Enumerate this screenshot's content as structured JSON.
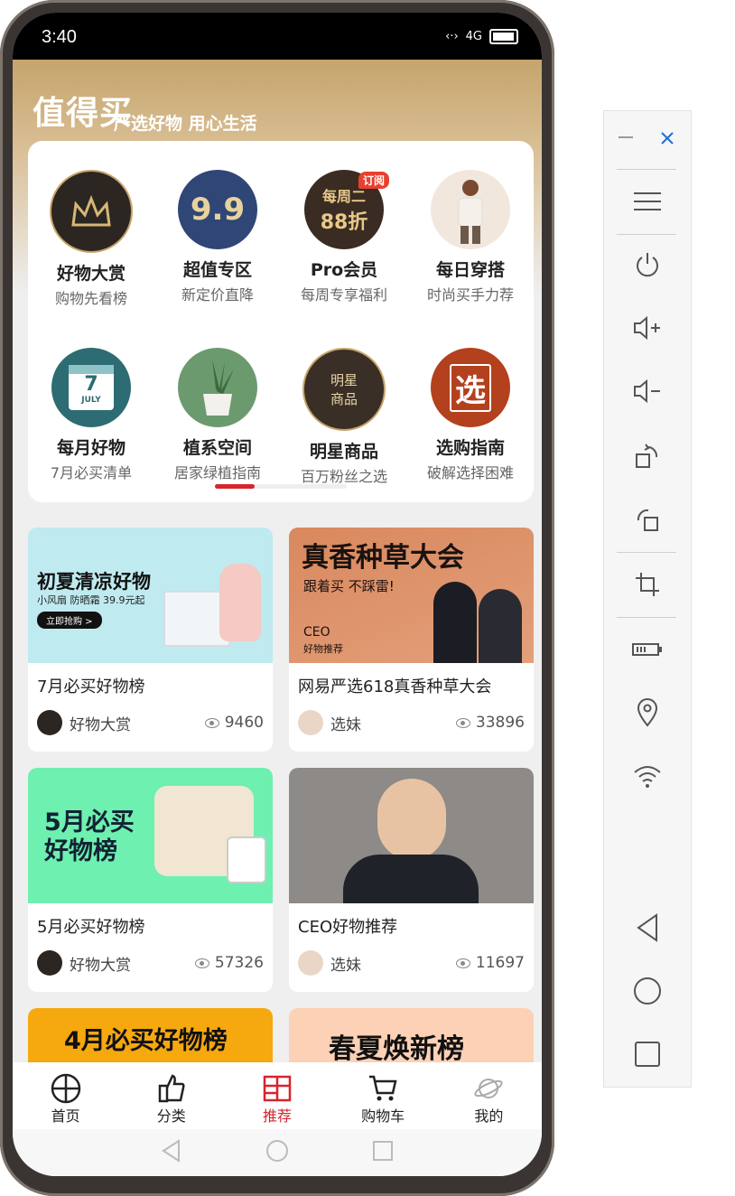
{
  "status": {
    "time": "3:40",
    "signal": "4G"
  },
  "header": {
    "brand": "值得买",
    "slogan": "严选好物 用心生活"
  },
  "categories": [
    {
      "title": "好物大赏",
      "sub": "购物先看榜",
      "icon": "crown-icon",
      "bg": "#2b2622"
    },
    {
      "title": "超值专区",
      "sub": "新定价直降",
      "icon": "price-99-icon",
      "bg": "#2f4677",
      "badge": "9.9"
    },
    {
      "title": "Pro会员",
      "sub": "每周专享福利",
      "icon": "pro-member-icon",
      "bg": "#3a2c22",
      "badge": "每周二",
      "badge2": "88折",
      "tag": "订阅"
    },
    {
      "title": "每日穿搭",
      "sub": "时尚买手力荐",
      "icon": "model-photo-icon",
      "bg": "#f1e7dd"
    },
    {
      "title": "每月好物",
      "sub": "7月必买清单",
      "icon": "calendar-icon",
      "bg": "#2d6c72",
      "badge": "7",
      "badge2": "JULY"
    },
    {
      "title": "植系空间",
      "sub": "居家绿植指南",
      "icon": "plant-icon",
      "bg": "#6c9a6f"
    },
    {
      "title": "明星商品",
      "sub": "百万粉丝之选",
      "icon": "star-product-icon",
      "bg": "#3a2f26",
      "badge": "明星",
      "badge2": "商品"
    },
    {
      "title": "选购指南",
      "sub": "破解选择困难",
      "icon": "guide-icon",
      "bg": "#b3411d",
      "badge": "选"
    }
  ],
  "feed": [
    {
      "title": "7月必买好物榜",
      "author": "好物大赏",
      "views": "9460",
      "banner": {
        "headline": "初夏清凉好物",
        "line": "小风扇 防晒霜 39.9元起",
        "cta": "立即抢购 >"
      }
    },
    {
      "title": "网易严选618真香种草大会",
      "author": "选妹",
      "views": "33896",
      "banner": {
        "headline": "真香种草大会",
        "line": "跟着买 不踩雷!",
        "cta": "CEO",
        "sub": "好物推荐"
      }
    },
    {
      "title": "5月必买好物榜",
      "author": "好物大赏",
      "views": "57326",
      "banner": {
        "headline": "5月必买",
        "line": "好物榜"
      }
    },
    {
      "title": "CEO好物推荐",
      "author": "选妹",
      "views": "11697",
      "banner": {}
    },
    {
      "title": "",
      "author": "",
      "views": "",
      "banner": {
        "headline": "4月必买好物榜"
      }
    },
    {
      "title": "",
      "author": "",
      "views": "",
      "banner": {
        "headline": "春夏焕新榜"
      }
    }
  ],
  "tabs": [
    {
      "label": "首页",
      "icon": "home-icon"
    },
    {
      "label": "分类",
      "icon": "category-icon"
    },
    {
      "label": "推荐",
      "icon": "recommend-icon",
      "active": true
    },
    {
      "label": "购物车",
      "icon": "cart-icon"
    },
    {
      "label": "我的",
      "icon": "profile-planet-icon"
    }
  ],
  "colors": {
    "accent": "#d9242c",
    "gold": "#c5a46d"
  }
}
